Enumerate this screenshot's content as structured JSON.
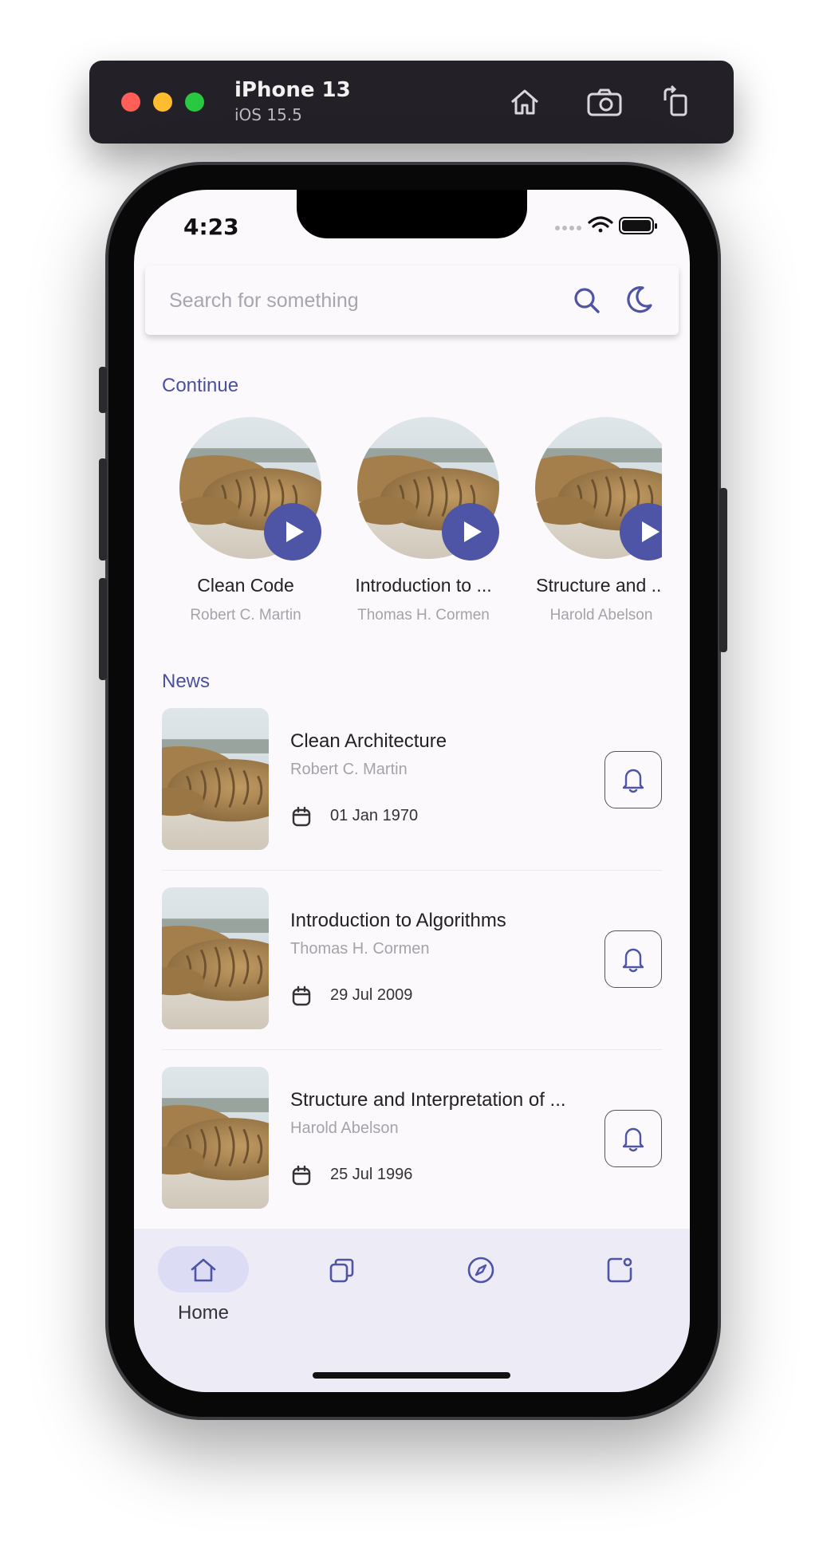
{
  "simulator": {
    "device": "iPhone 13",
    "os": "iOS 15.5",
    "buttons": [
      "home-icon",
      "screenshot-icon",
      "rotate-icon"
    ]
  },
  "status_bar": {
    "time": "4:23"
  },
  "search": {
    "placeholder": "Search for something"
  },
  "continue": {
    "title": "Continue",
    "items": [
      {
        "title": "Clean Code",
        "author": "Robert C. Martin"
      },
      {
        "title": "Introduction to ...",
        "author": "Thomas H. Cormen"
      },
      {
        "title": "Structure and ...",
        "author": "Harold Abelson"
      }
    ]
  },
  "news": {
    "title": "News",
    "items": [
      {
        "title": "Clean Architecture",
        "author": "Robert C. Martin",
        "date": "01 Jan 1970"
      },
      {
        "title": "Introduction to Algorithms",
        "author": "Thomas H. Cormen",
        "date": "29 Jul 2009"
      },
      {
        "title": "Structure and Interpretation of ...",
        "author": "Harold Abelson",
        "date": "25 Jul 1996"
      }
    ]
  },
  "bottom_nav": {
    "items": [
      {
        "label": "Home",
        "icon": "home-icon",
        "active": true
      },
      {
        "label": "",
        "icon": "library-icon",
        "active": false
      },
      {
        "label": "",
        "icon": "compass-icon",
        "active": false
      },
      {
        "label": "",
        "icon": "profile-icon",
        "active": false
      }
    ]
  },
  "colors": {
    "accent": "#4e54a6",
    "background": "#fcf9fc",
    "nav_bg": "#edebf6",
    "nav_pill": "#dddcf5"
  }
}
